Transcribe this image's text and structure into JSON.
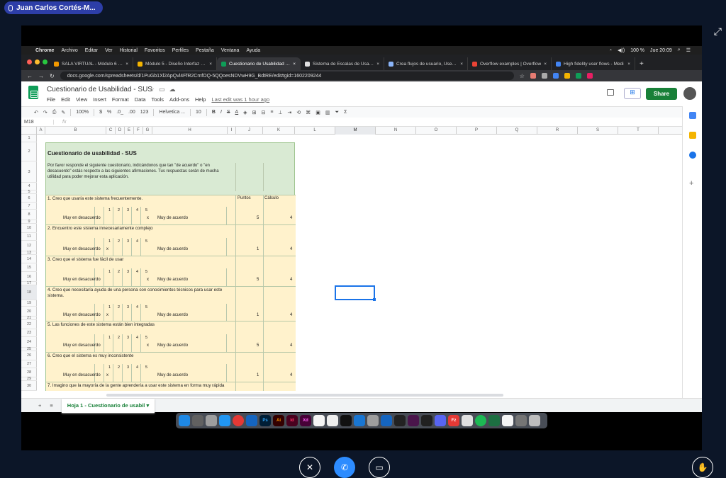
{
  "meeting": {
    "speaker_name": "Juan Carlos Cortés-M..."
  },
  "mac_menu": {
    "app": "Chrome",
    "items": [
      "Archivo",
      "Editar",
      "Ver",
      "Historial",
      "Favoritos",
      "Perfiles",
      "Pestaña",
      "Ventana",
      "Ayuda"
    ],
    "battery": "100 %",
    "clock": "Jue 20:09"
  },
  "tabs": [
    {
      "label": "SALA VIRTUAL - Módulo 6 ses",
      "color": "#f29900"
    },
    {
      "label": "Módulo 5 - Diseño Interfaz y di",
      "color": "#f4b400"
    },
    {
      "label": "Cuestionario de Usabilidad - SU",
      "color": "#0f9d58",
      "active": true
    },
    {
      "label": "Sistema de Escalas de Usabilid",
      "color": "#e0e0e0"
    },
    {
      "label": "Crea flujos de usuario, User Fl",
      "color": "#8ab4f8"
    },
    {
      "label": "Overflow examples | Overflow",
      "color": "#ea4335"
    },
    {
      "label": "High fidelity user flows - Medi",
      "color": "#4285f4"
    }
  ],
  "url": "docs.google.com/spreadsheets/d/1PuGb1Xl2ApQvl4FfR2CmfOQ-5QQoesNDVwH9G_BdtRE/edit#gid=1602209244",
  "doc": {
    "title": "Cuestionario de Usabilidad - SUS",
    "menus": [
      "File",
      "Edit",
      "View",
      "Insert",
      "Format",
      "Data",
      "Tools",
      "Add-ons",
      "Help"
    ],
    "last_edit": "Last edit was 1 hour ago",
    "share": "Share"
  },
  "toolbar": {
    "zoom": "100%",
    "currency": "$",
    "percent": "%",
    "dec1": ".0_",
    "dec2": ".00",
    "fmt": "123",
    "font": "Helvetica ...",
    "size": "10"
  },
  "formula": {
    "cell": "M18",
    "fx": "fx"
  },
  "columns": [
    "A",
    "B",
    "C",
    "D",
    "E",
    "F",
    "G",
    "H",
    "I",
    "J",
    "K",
    "L",
    "M",
    "N",
    "O",
    "P",
    "Q",
    "R",
    "S",
    "T"
  ],
  "rows": [
    "1",
    "2",
    "3",
    "4",
    "5",
    "6",
    "7",
    "8",
    "9",
    "10",
    "11",
    "12",
    "13",
    "14",
    "15",
    "16",
    "17",
    "18",
    "19",
    "20",
    "21",
    "22",
    "23",
    "24",
    "25",
    "26",
    "27",
    "28",
    "29",
    "30"
  ],
  "sheet": {
    "heading": "Cuestionario de usabilidad - SUS",
    "intro": "Por favor responde el siguiente cuestionario, indicándonos que tan \"de acuerdo\" o \"en desacuerdo\" estás respecto a las siguientes afirmaciones. Tus respuestas serán de mucha utilidad para poder mejorar esta aplicación.",
    "col_puntos": "Puntos",
    "col_calculo": "Cálculo",
    "low": "Muy en desacuerdo",
    "high": "Muy de acuerdo",
    "scale": [
      "1",
      "2",
      "3",
      "4",
      "5"
    ],
    "mark": "x",
    "questions": [
      {
        "text": "1. Creo que usaría este sistema frecuentemente.",
        "puntos": "5",
        "calculo": "4",
        "mark": "high"
      },
      {
        "text": "2. Encuentro este sistema innecesariamente complejo",
        "puntos": "1",
        "calculo": "4",
        "mark": "low"
      },
      {
        "text": "3. Creo que el sistema fue fácil de usar",
        "puntos": "5",
        "calculo": "4",
        "mark": "high"
      },
      {
        "text": "4. Creo que necesitaría ayuda de una persona con conocimientos técnicos para usar este sistema.",
        "puntos": "1",
        "calculo": "4",
        "mark": "low"
      },
      {
        "text": "5. Las funciones de este sistema están bien integradas",
        "puntos": "5",
        "calculo": "4",
        "mark": "high"
      },
      {
        "text": "6. Creo que el sistema es muy inconsistente",
        "puntos": "1",
        "calculo": "4",
        "mark": "low"
      },
      {
        "text": "7. Imagino que la mayoría de la gente aprendería a usar este sistema en forma muy rápida",
        "puntos": "",
        "calculo": "",
        "mark": "none"
      }
    ]
  },
  "sheet_tab": "Hoja 1 - Cuestionario de usabil"
}
